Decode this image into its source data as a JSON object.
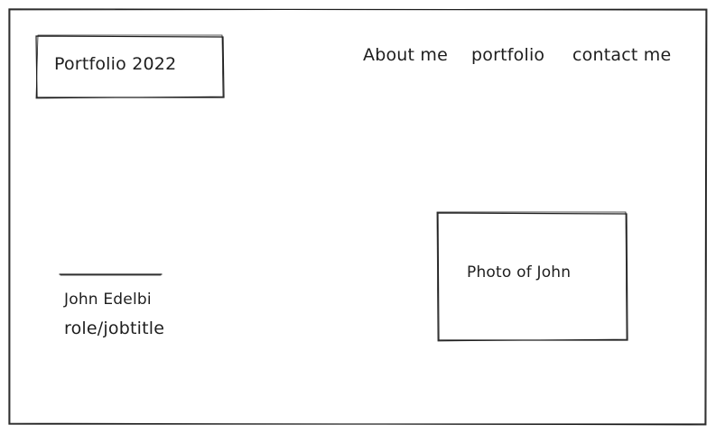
{
  "header": {
    "logo_text": "Portfolio 2022",
    "nav": [
      {
        "label": "About me"
      },
      {
        "label": "portfolio"
      },
      {
        "label": "contact me"
      }
    ]
  },
  "hero": {
    "name": "John Edelbi",
    "role": "role/jobtitle",
    "photo_placeholder": "Photo of John"
  },
  "colors": {
    "stroke": "#1e1e1e",
    "background": "#ffffff"
  }
}
